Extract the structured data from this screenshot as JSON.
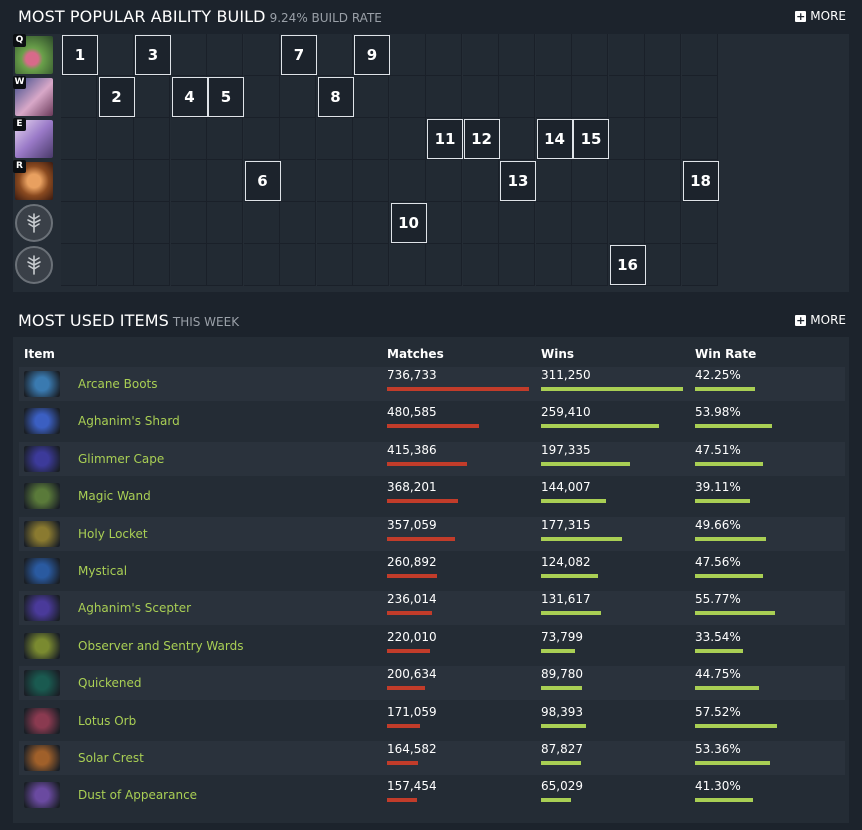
{
  "ability_build": {
    "title": "MOST POPULAR ABILITY BUILD",
    "subtitle": "9.24% BUILD RATE",
    "more_label": "MORE",
    "rows": [
      {
        "hotkey": "Q",
        "icon": "skill-q-icon",
        "levels": [
          1,
          3,
          7,
          9
        ]
      },
      {
        "hotkey": "W",
        "icon": "skill-w-icon",
        "levels": [
          2,
          4,
          5,
          8
        ]
      },
      {
        "hotkey": "E",
        "icon": "skill-e-icon",
        "levels": [
          11,
          12,
          14,
          15
        ]
      },
      {
        "hotkey": "R",
        "icon": "skill-r-icon",
        "levels": [
          6,
          13,
          18
        ]
      },
      {
        "hotkey": "",
        "icon": "talent-tree-icon",
        "levels": [
          10
        ]
      },
      {
        "hotkey": "",
        "icon": "talent-tree-icon",
        "levels": [
          16
        ]
      }
    ]
  },
  "items": {
    "title": "MOST USED ITEMS",
    "subtitle": "THIS WEEK",
    "more_label": "MORE",
    "headers": {
      "item": "Item",
      "matches": "Matches",
      "wins": "Wins",
      "win_rate": "Win Rate"
    },
    "rows": [
      {
        "name": "Arcane Boots",
        "icon": "arcane-boots-icon",
        "matches": "736,733",
        "wins": "311,250",
        "win_rate": "42.25%",
        "matches_frac": 1.0,
        "wins_frac": 1.0,
        "wr_frac": 0.42,
        "color": "#3a7ab0"
      },
      {
        "name": "Aghanim's Shard",
        "icon": "aghanims-shard-icon",
        "matches": "480,585",
        "wins": "259,410",
        "win_rate": "53.98%",
        "matches_frac": 0.65,
        "wins_frac": 0.83,
        "wr_frac": 0.54,
        "color": "#3b5fc2"
      },
      {
        "name": "Glimmer Cape",
        "icon": "glimmer-cape-icon",
        "matches": "415,386",
        "wins": "197,335",
        "win_rate": "47.51%",
        "matches_frac": 0.56,
        "wins_frac": 0.63,
        "wr_frac": 0.48,
        "color": "#3c3a9a"
      },
      {
        "name": "Magic Wand",
        "icon": "magic-wand-icon",
        "matches": "368,201",
        "wins": "144,007",
        "win_rate": "39.11%",
        "matches_frac": 0.5,
        "wins_frac": 0.46,
        "wr_frac": 0.39,
        "color": "#5a7a3a"
      },
      {
        "name": "Holy Locket",
        "icon": "holy-locket-icon",
        "matches": "357,059",
        "wins": "177,315",
        "win_rate": "49.66%",
        "matches_frac": 0.48,
        "wins_frac": 0.57,
        "wr_frac": 0.5,
        "color": "#8a7a30"
      },
      {
        "name": "Mystical",
        "icon": "mystical-icon",
        "matches": "260,892",
        "wins": "124,082",
        "win_rate": "47.56%",
        "matches_frac": 0.35,
        "wins_frac": 0.4,
        "wr_frac": 0.48,
        "color": "#2a5aa0"
      },
      {
        "name": "Aghanim's Scepter",
        "icon": "aghanims-scepter-icon",
        "matches": "236,014",
        "wins": "131,617",
        "win_rate": "55.77%",
        "matches_frac": 0.32,
        "wins_frac": 0.42,
        "wr_frac": 0.56,
        "color": "#4a3a9a"
      },
      {
        "name": "Observer and Sentry Wards",
        "icon": "observer-sentry-wards-icon",
        "matches": "220,010",
        "wins": "73,799",
        "win_rate": "33.54%",
        "matches_frac": 0.3,
        "wins_frac": 0.24,
        "wr_frac": 0.34,
        "color": "#7a8a30"
      },
      {
        "name": "Quickened",
        "icon": "quickened-icon",
        "matches": "200,634",
        "wins": "89,780",
        "win_rate": "44.75%",
        "matches_frac": 0.27,
        "wins_frac": 0.29,
        "wr_frac": 0.45,
        "color": "#1a5a50"
      },
      {
        "name": "Lotus Orb",
        "icon": "lotus-orb-icon",
        "matches": "171,059",
        "wins": "98,393",
        "win_rate": "57.52%",
        "matches_frac": 0.23,
        "wins_frac": 0.32,
        "wr_frac": 0.58,
        "color": "#8a3a50"
      },
      {
        "name": "Solar Crest",
        "icon": "solar-crest-icon",
        "matches": "164,582",
        "wins": "87,827",
        "win_rate": "53.36%",
        "matches_frac": 0.22,
        "wins_frac": 0.28,
        "wr_frac": 0.53,
        "color": "#a0602a"
      },
      {
        "name": "Dust of Appearance",
        "icon": "dust-of-appearance-icon",
        "matches": "157,454",
        "wins": "65,029",
        "win_rate": "41.30%",
        "matches_frac": 0.21,
        "wins_frac": 0.21,
        "wr_frac": 0.41,
        "color": "#6a4aa0"
      }
    ]
  }
}
